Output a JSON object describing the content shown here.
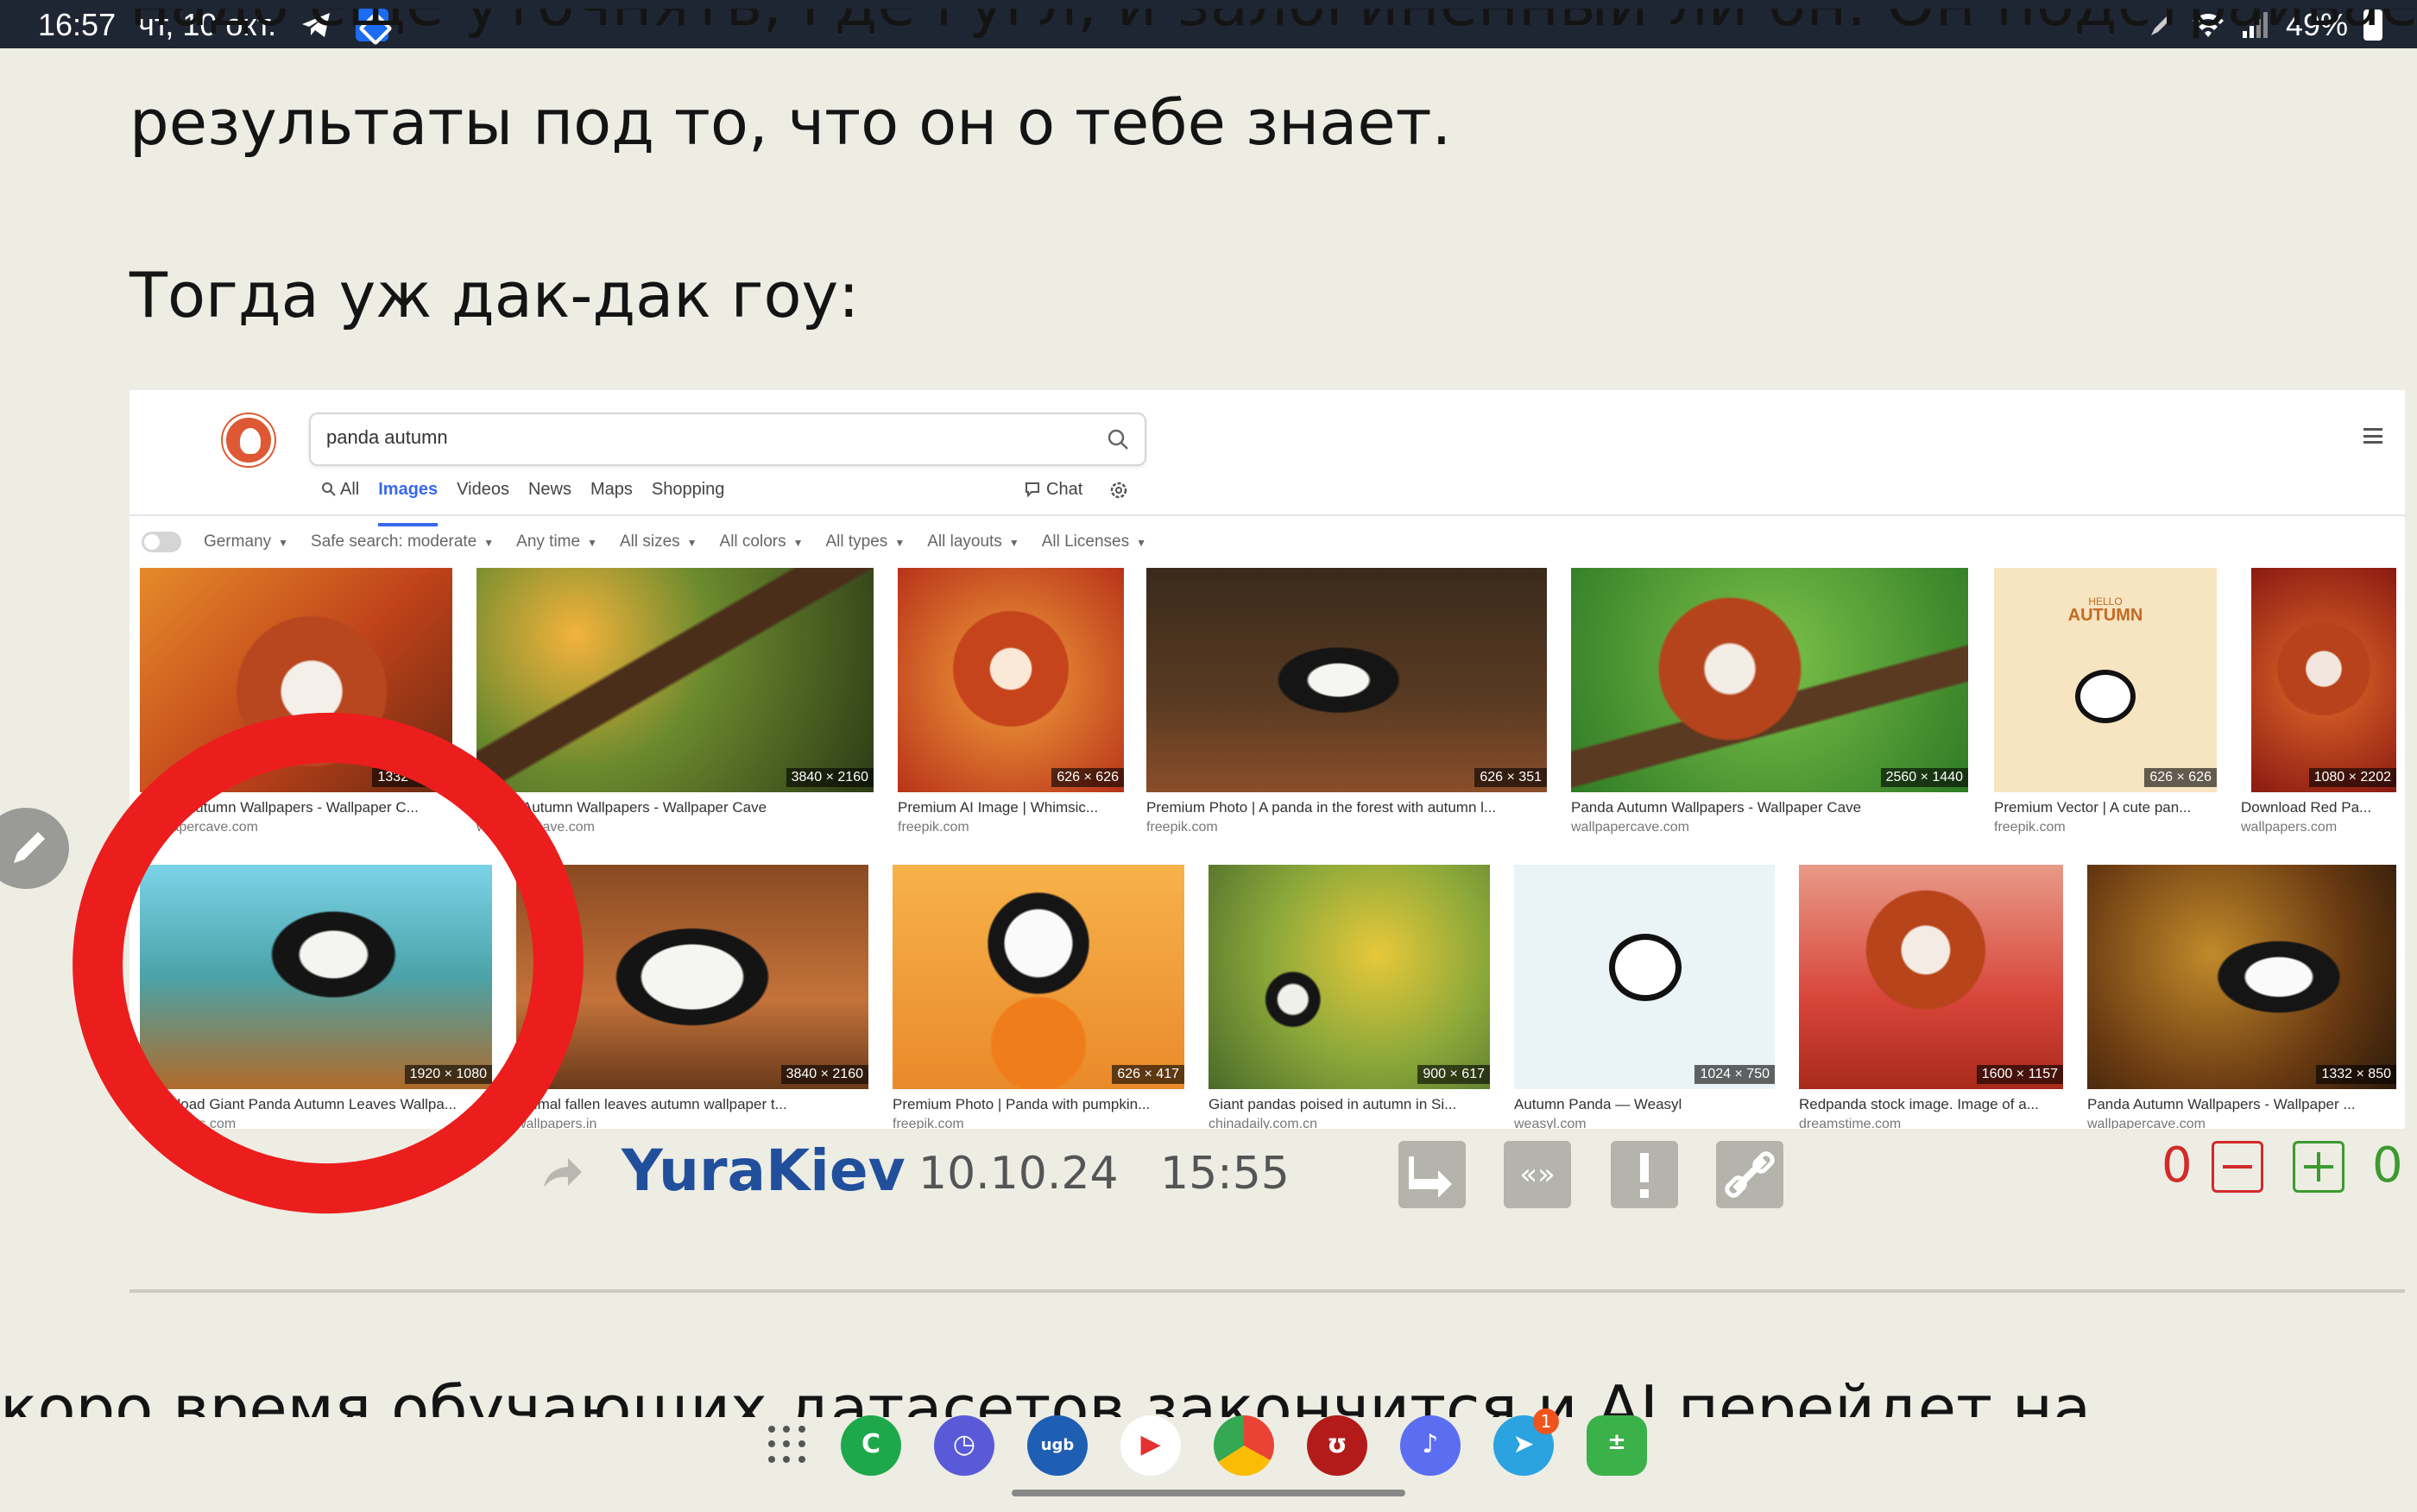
{
  "status_bar": {
    "time": "16:57",
    "date": "чт, 10 окт.",
    "battery": "49%"
  },
  "post": {
    "line1": "надо ещё уточнять, где гугл, и залогиненный ли он. Он подстраивает",
    "line2": "результаты под то, что он о тебе знает.",
    "line3": "Тогда уж дак-дак гоу:",
    "next_line": "коро время обучающих датасетов закончится и AI перейдет на"
  },
  "screenshot": {
    "search": {
      "query": "panda autumn"
    },
    "tabs": [
      "All",
      "Images",
      "Videos",
      "News",
      "Maps",
      "Shopping"
    ],
    "active_tab": "Images",
    "chat_label": "Chat",
    "filters": [
      "Germany",
      "Safe search: moderate",
      "Any time",
      "All sizes",
      "All colors",
      "All types",
      "All layouts",
      "All Licenses"
    ],
    "row1": [
      {
        "dims": "1332 × 850",
        "caption": "Panda Autumn Wallpapers - Wallpaper C...",
        "source": "wallpapercave.com"
      },
      {
        "dims": "3840 × 2160",
        "caption": "Panda Autumn Wallpapers - Wallpaper Cave",
        "source": "wallpapercave.com"
      },
      {
        "dims": "626 × 626",
        "caption": "Premium AI Image | Whimsic...",
        "source": "freepik.com"
      },
      {
        "dims": "626 × 351",
        "caption": "Premium Photo | A panda in the forest with autumn l...",
        "source": "freepik.com"
      },
      {
        "dims": "2560 × 1440",
        "caption": "Panda Autumn Wallpapers - Wallpaper Cave",
        "source": "wallpapercave.com"
      },
      {
        "dims": "626 × 626",
        "caption": "Premium Vector | A cute pan...",
        "source": "freepik.com"
      },
      {
        "dims": "1080 × 2202",
        "caption": "Download Red Pa...",
        "source": "wallpapers.com"
      }
    ],
    "row2": [
      {
        "dims": "1920 × 1080",
        "caption": "Download Giant Panda Autumn Leaves Wallpa...",
        "source": "wallpapers.com"
      },
      {
        "dims": "3840 × 2160",
        "caption": "Animal fallen leaves autumn wallpaper t...",
        "source": "wallpapers.in"
      },
      {
        "dims": "626 × 417",
        "caption": "Premium Photo | Panda with pumpkin...",
        "source": "freepik.com"
      },
      {
        "dims": "900 × 617",
        "caption": "Giant pandas poised in autumn in Si...",
        "source": "chinadaily.com.cn"
      },
      {
        "dims": "1024 × 750",
        "caption": "Autumn Panda — Weasyl",
        "source": "weasyl.com"
      },
      {
        "dims": "1600 × 1157",
        "caption": "Redpanda stock image. Image of a...",
        "source": "dreamstime.com"
      },
      {
        "dims": "1332 × 850",
        "caption": "Panda Autumn Wallpapers - Wallpaper ...",
        "source": "wallpapercave.com"
      }
    ],
    "vector_title": "AUTUMN",
    "vector_hello": "HELLO"
  },
  "meta": {
    "author": "YuraKiev",
    "date": "10.10.24",
    "time": "15:55",
    "minus_score": "0",
    "plus_score": "0"
  },
  "dock": {
    "telegram_badge": "1"
  },
  "colors": {
    "link": "#214f9c",
    "accent": "#3969ef",
    "red_mark": "#ec1d1d",
    "minus": "#d32a2a",
    "plus": "#3d9a31"
  }
}
